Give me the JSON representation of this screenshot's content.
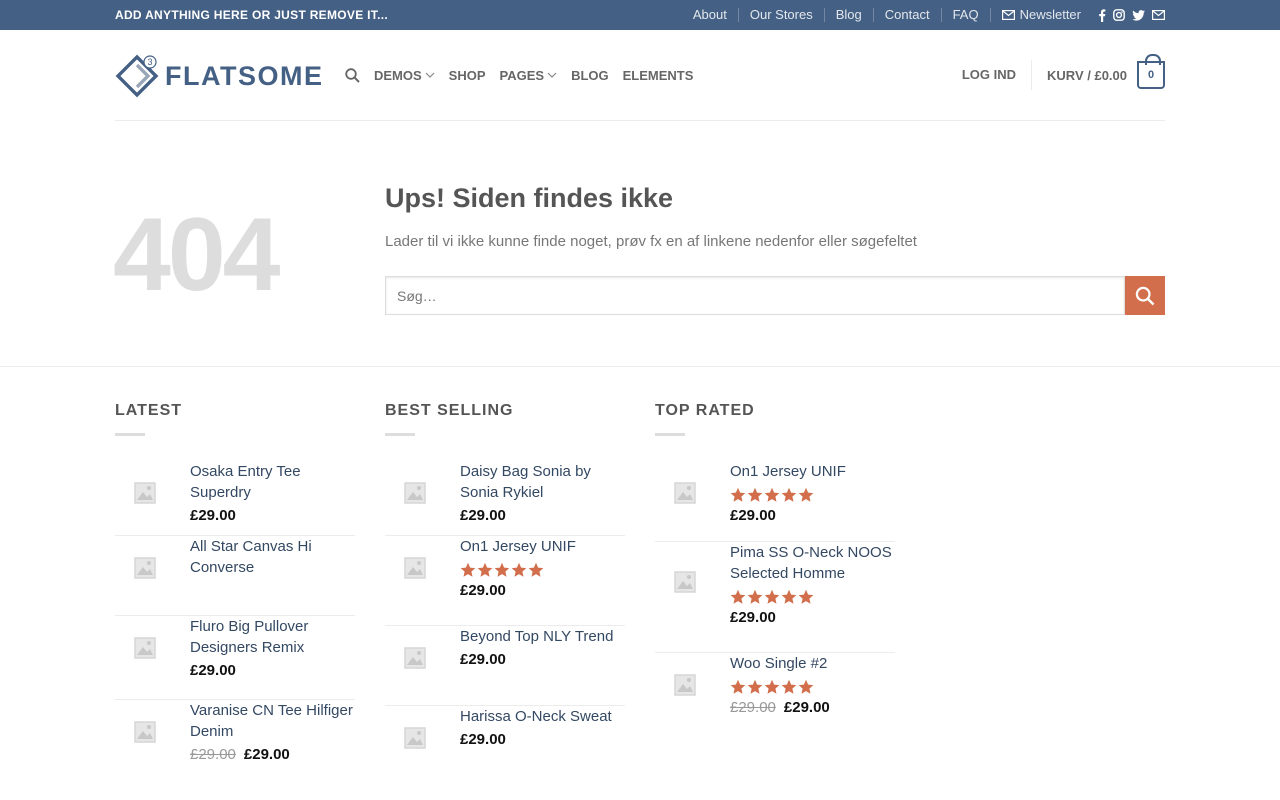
{
  "topbar": {
    "message": "ADD ANYTHING HERE OR JUST REMOVE IT...",
    "links": [
      "About",
      "Our Stores",
      "Blog",
      "Contact",
      "FAQ"
    ],
    "newsletter": "Newsletter",
    "social_icons": [
      "facebook-icon",
      "instagram-icon",
      "twitter-icon",
      "email-icon"
    ]
  },
  "header": {
    "logo_text": "FLATSOME",
    "logo_badge": "3",
    "nav": [
      "DEMOS",
      "SHOP",
      "PAGES",
      "BLOG",
      "ELEMENTS"
    ],
    "login": "LOG IND",
    "cart_label": "KURV / £0.00",
    "cart_count": "0"
  },
  "error": {
    "code": "404",
    "title": "Ups! Siden findes ikke",
    "text": "Lader til vi ikke kunne finde noget, prøv fx en af linkene nedenfor eller søgefeltet",
    "search_placeholder": "Søg…"
  },
  "colors": {
    "topbar": "#446084",
    "accent": "#d26e4b",
    "link": "#334862"
  },
  "widgets": {
    "latest": {
      "title": "LATEST",
      "items": [
        {
          "name": "Osaka Entry Tee Superdry",
          "price": "£29.00"
        },
        {
          "name": "All Star Canvas Hi Converse",
          "price": ""
        },
        {
          "name": "Fluro Big Pullover Designers Remix",
          "price": "£29.00"
        },
        {
          "name": "Varanise CN Tee Hilfiger Denim",
          "old_price": "£29.00",
          "price": "£29.00"
        }
      ]
    },
    "best_selling": {
      "title": "BEST SELLING",
      "items": [
        {
          "name": "Daisy Bag Sonia by Sonia Rykiel",
          "price": "£29.00"
        },
        {
          "name": "On1 Jersey UNIF",
          "rating": 5,
          "price": "£29.00"
        },
        {
          "name": "Beyond Top NLY Trend",
          "price": "£29.00"
        },
        {
          "name": "Harissa O-Neck Sweat",
          "price": "£29.00"
        }
      ]
    },
    "top_rated": {
      "title": "TOP RATED",
      "items": [
        {
          "name": "On1 Jersey UNIF",
          "rating": 5,
          "price": "£29.00"
        },
        {
          "name": "Pima SS O-Neck NOOS Selected Homme",
          "rating": 5,
          "price": "£29.00"
        },
        {
          "name": "Woo Single #2",
          "rating": 5,
          "old_price": "£29.00",
          "price": "£29.00"
        }
      ]
    }
  }
}
